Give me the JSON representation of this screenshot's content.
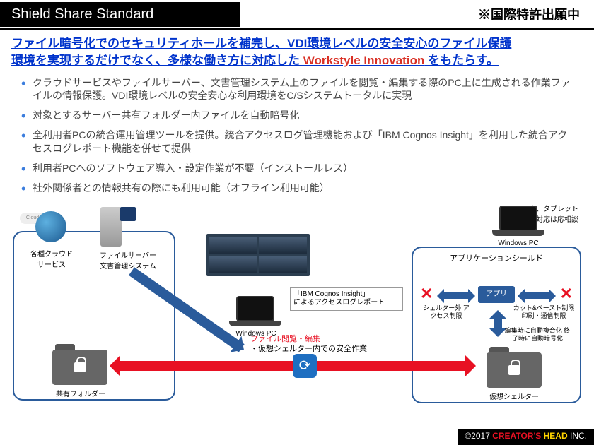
{
  "header": {
    "title": "Shield Share Standard",
    "patent_notice": "※国際特許出願中"
  },
  "subtitle": {
    "line_a": "ファイル暗号化でのセキュリティホールを補完し、VDI環境レベルの安全安心のファイル保護",
    "line_b_pre": "環境を実現するだけでなく、多様な働き方に対応した ",
    "line_b_red": "Workstyle Innovation",
    "line_b_post": " をもたらす。"
  },
  "bullets": [
    "クラウドサービスやファイルサーバー、文書管理システム上のファイルを閲覧・編集する際のPC上に生成される作業ファイルの情報保護。VDI環境レベルの安全安心な利用環境をC/Sシステムトータルに実現",
    "対象とするサーバー共有フォルダー内ファイルを自動暗号化",
    "全利用者PCの統合運用管理ツールを提供。統合アクセスログ管理機能および「IBM Cognos Insight」を利用した統合アクセスログレポート機能を併せて提供",
    "利用者PCへのソフトウェア導入・設定作業が不要（インストールレス）",
    "社外関係者との情報共有の際にも利用可能（オフライン利用可能）"
  ],
  "diagram": {
    "cloud_label": "各種クラウド\nサービス",
    "cloud_badge": "Cloud",
    "server_label": "ファイルサーバー\n文書管理システム",
    "shared_folder_label": "共有フォルダー",
    "virtual_shelter_label": "仮想シェルター",
    "windows_pc_center": "Windows PC",
    "windows_pc_right": "Windows PC",
    "cognos_label": "「IBM Cognos Insight」\nによるアクセスログレポート",
    "note_right": "※スマホ、タブレット\n対応は応相談",
    "appshield_title": "アプリケーションシールド",
    "app_core": "アプリ",
    "shelter_out": "シェルター外\nアクセス制限",
    "cut_paste": "カット&ペースト制限\n印刷・通信制限",
    "auto_lines": "編集時に自動複合化\n終了時に自動暗号化",
    "mid_red": "ファイル閲覧・編集",
    "mid_black": "・仮想シェルター内での安全作業"
  },
  "footer": {
    "copyright": "©2017 ",
    "brand_a": "CREATOR'S ",
    "brand_b": "HEAD",
    "brand_c": " INC."
  }
}
